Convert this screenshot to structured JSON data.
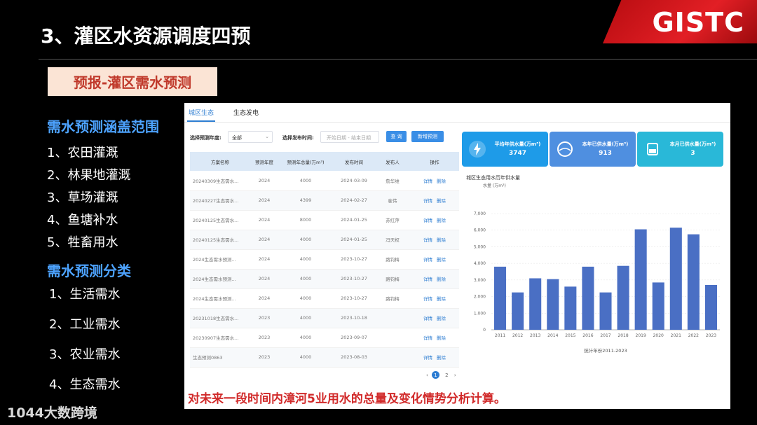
{
  "slide": {
    "title": "3、灌区水资源调度四预",
    "logo": "GISTC",
    "tag": "预报-灌区需水预测",
    "scope_heading": "需水预测涵盖范围",
    "scope_items": [
      "1、农田灌溉",
      "2、林果地灌溉",
      "3、草场灌溉",
      "4、鱼塘补水",
      "5、牲畜用水"
    ],
    "class_heading": "需水预测分类",
    "class_items": [
      "1、生活需水",
      "2、工业需水",
      "3、农业需水",
      "4、生态需水"
    ],
    "watermark": "1044大数跨境",
    "bottom_note": "对未来一段时间内漳河5业用水的总量及变化情势分析计算。"
  },
  "app": {
    "tabs": [
      "城区生态",
      "生态发电"
    ],
    "filters": {
      "year_label": "选择预测年度:",
      "year_value": "全部",
      "date_label": "选择发布时间:",
      "date_placeholder": "开始日期 - 结束日期",
      "query_label": "查 询",
      "add_label": "新增预测"
    },
    "table": {
      "headers": [
        "方案名称",
        "预测年度",
        "预测年总量(万m³)",
        "发布时间",
        "发布人",
        "操作"
      ],
      "rows": [
        [
          "20240309生态需水...",
          "2024",
          "4000",
          "2024-03-09",
          "詹华维",
          "详情",
          "删除"
        ],
        [
          "20240227生态需水...",
          "2024",
          "4399",
          "2024-02-27",
          "崔伟",
          "详情",
          "删除"
        ],
        [
          "20240125生态需水...",
          "2024",
          "8000",
          "2024-01-25",
          "苏红萍",
          "详情",
          "删除"
        ],
        [
          "20240125生态需水...",
          "2024",
          "4000",
          "2024-01-25",
          "冯天权",
          "详情",
          "删除"
        ],
        [
          "2024生态需水预测...",
          "2024",
          "4000",
          "2023-10-27",
          "路钧梅",
          "详情",
          "删除"
        ],
        [
          "2024生态需水预测...",
          "2024",
          "4000",
          "2023-10-27",
          "路钧梅",
          "详情",
          "删除"
        ],
        [
          "2024生态需水预测...",
          "2024",
          "4000",
          "2023-10-27",
          "路钧梅",
          "详情",
          "删除"
        ],
        [
          "20231018生态需水...",
          "2023",
          "4000",
          "2023-10-18",
          "",
          "详情",
          "删除"
        ],
        [
          "20230907生态需水...",
          "2023",
          "4000",
          "2023-09-07",
          "",
          "详情",
          "删除"
        ],
        [
          "生态预测0863",
          "2023",
          "4000",
          "2023-08-03",
          "",
          "详情",
          "删除"
        ]
      ]
    },
    "pager": {
      "prev": "‹",
      "pages": [
        "1",
        "2"
      ],
      "next": "›"
    },
    "cards": [
      {
        "title": "平均年供水量(万m³)",
        "value": "3747",
        "color": "#1e9be8"
      },
      {
        "title": "本年已供水量(万m³)",
        "value": "913",
        "color": "#4f8fe0"
      },
      {
        "title": "本月已供水量(万m³)",
        "value": "3",
        "color": "#29b8d8"
      }
    ]
  },
  "chart_data": {
    "type": "bar",
    "title": "城区生态用水历年供水量",
    "ylabel": "水量 (万m³)",
    "xlabel": "统计年份2011-2023",
    "categories": [
      "2011",
      "2012",
      "2013",
      "2014",
      "2015",
      "2016",
      "2017",
      "2018",
      "2019",
      "2020",
      "2021",
      "2022",
      "2023"
    ],
    "values": [
      3800,
      2250,
      3100,
      3050,
      2600,
      3800,
      2250,
      3850,
      6050,
      2850,
      6150,
      5750,
      2700
    ],
    "yticks": [
      0,
      1000,
      2000,
      3000,
      4000,
      5000,
      6000,
      7000
    ],
    "ytick_labels": [
      "0",
      "1,000",
      "2,000",
      "3,000",
      "4,000",
      "5,000",
      "6,000",
      "7,000"
    ],
    "ylim": [
      0,
      7000
    ],
    "bar_color": "#4a6fc4"
  }
}
